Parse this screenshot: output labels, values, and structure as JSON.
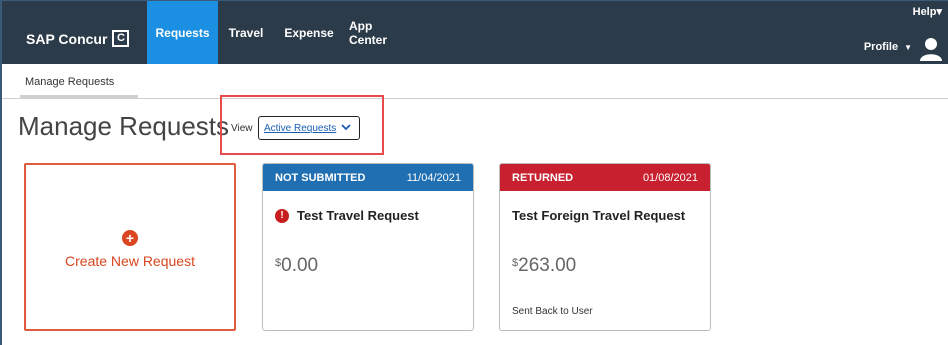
{
  "header": {
    "logo_text": "SAP Concur",
    "logo_mark": "C",
    "nav": [
      {
        "label": "Requests",
        "active": true
      },
      {
        "label": "Travel",
        "active": false
      },
      {
        "label": "Expense",
        "active": false
      },
      {
        "label": "App Center",
        "active": false
      }
    ],
    "help_label": "Help",
    "help_caret": "▾",
    "profile_label": "Profile",
    "profile_caret": "▼",
    "colors": {
      "bar": "#2c3b49",
      "active_tab": "#1b8fe1"
    }
  },
  "breadcrumb": {
    "label": "Manage Requests"
  },
  "page": {
    "title": "Manage Requests",
    "view_label": "View",
    "view_value": "Active Requests"
  },
  "create_card": {
    "icon": "plus-circle-icon",
    "icon_glyph": "+",
    "label": "Create New Request",
    "color": "#d9461f"
  },
  "requests": [
    {
      "status": "NOT SUBMITTED",
      "date": "11/04/2021",
      "header_color": "#1f6fb2",
      "alert_icon": "exclamation-circle-icon",
      "alert_glyph": "!",
      "title": "Test Travel Request",
      "currency": "$",
      "amount": "0.00",
      "note": ""
    },
    {
      "status": "RETURNED",
      "date": "01/08/2021",
      "header_color": "#c8202f",
      "title": "Test Foreign Travel Request",
      "currency": "$",
      "amount": "263.00",
      "note": "Sent Back to User"
    }
  ]
}
